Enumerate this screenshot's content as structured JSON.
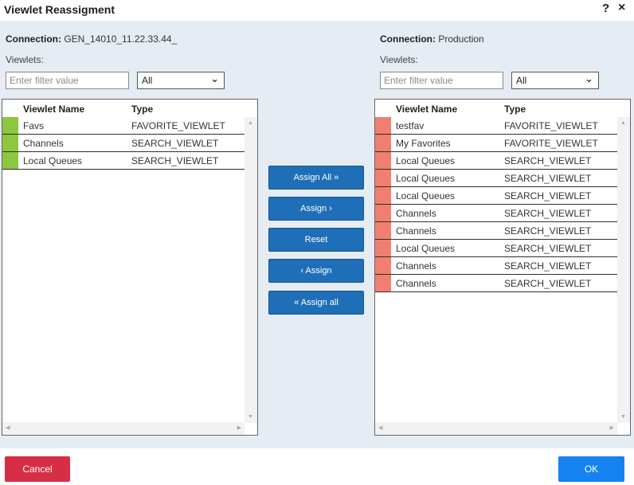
{
  "dialog": {
    "title": "Viewlet Reassigment",
    "help_label": "?",
    "close_label": "×"
  },
  "left": {
    "connection_label": "Connection:",
    "connection_value": " GEN_14010_11.22.33.44_",
    "viewlets_label": "Viewlets:",
    "filter_placeholder": "Enter filter value",
    "select_value": "All",
    "columns": {
      "name": "Viewlet Name",
      "type": "Type"
    },
    "marker_color": "#8dc63f",
    "rows": [
      {
        "name": "Favs",
        "type": "FAVORITE_VIEWLET"
      },
      {
        "name": "Channels",
        "type": "SEARCH_VIEWLET"
      },
      {
        "name": "Local Queues",
        "type": "SEARCH_VIEWLET"
      }
    ]
  },
  "right": {
    "connection_label": "Connection:",
    "connection_value": " Production",
    "viewlets_label": "Viewlets:",
    "filter_placeholder": "Enter filter value",
    "select_value": "All",
    "columns": {
      "name": "Viewlet Name",
      "type": "Type"
    },
    "marker_color": "#f07f73",
    "rows": [
      {
        "name": "testfav",
        "type": "FAVORITE_VIEWLET"
      },
      {
        "name": "My Favorites",
        "type": "FAVORITE_VIEWLET"
      },
      {
        "name": "Local Queues",
        "type": "SEARCH_VIEWLET"
      },
      {
        "name": "Local Queues",
        "type": "SEARCH_VIEWLET"
      },
      {
        "name": "Local Queues",
        "type": "SEARCH_VIEWLET"
      },
      {
        "name": "Channels",
        "type": "SEARCH_VIEWLET"
      },
      {
        "name": "Channels",
        "type": "SEARCH_VIEWLET"
      },
      {
        "name": "Local Queues",
        "type": "SEARCH_VIEWLET"
      },
      {
        "name": "Channels",
        "type": "SEARCH_VIEWLET"
      },
      {
        "name": "Channels",
        "type": "SEARCH_VIEWLET"
      }
    ]
  },
  "actions": {
    "assign_all_right": "Assign All »",
    "assign_right": "Assign ›",
    "reset": "Reset",
    "assign_left": "‹ Assign",
    "assign_all_left": "« Assign all"
  },
  "footer": {
    "cancel_label": "Cancel",
    "ok_label": "OK"
  },
  "colors": {
    "primary_button": "#1f6fb8",
    "cancel_button": "#d62e45",
    "ok_button": "#1682f0",
    "content_bg": "#e6ecf3"
  }
}
